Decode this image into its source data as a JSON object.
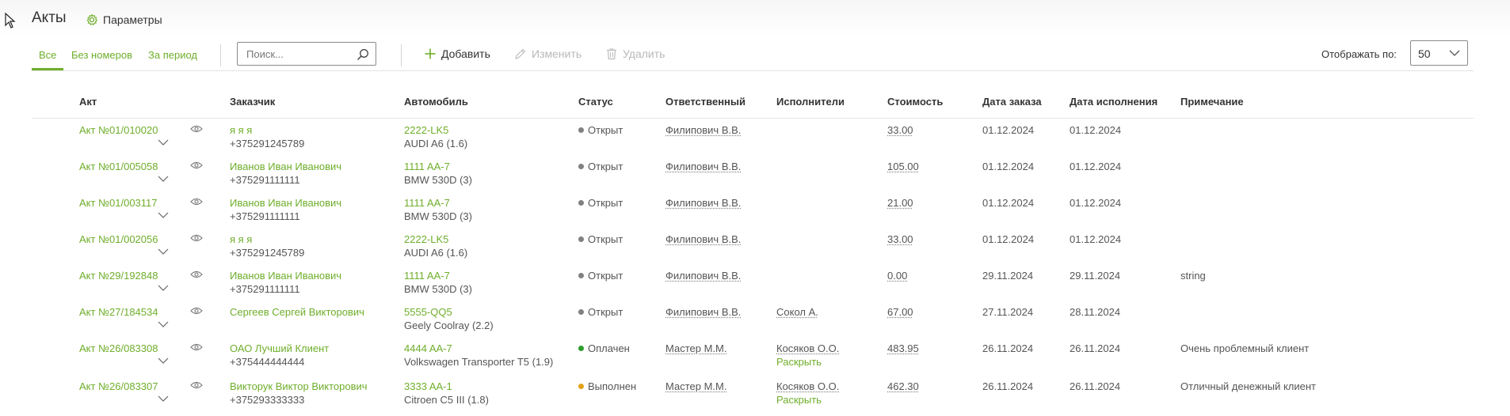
{
  "header": {
    "title": "Акты",
    "params_label": "Параметры"
  },
  "tabs": [
    {
      "label": "Все",
      "active": true
    },
    {
      "label": "Без номеров",
      "active": false
    },
    {
      "label": "За период",
      "active": false
    }
  ],
  "search": {
    "placeholder": "Поиск...",
    "value": ""
  },
  "actions": {
    "add": "Добавить",
    "edit": "Изменить",
    "delete": "Удалить"
  },
  "pager": {
    "label": "Отображать по:",
    "value": "50"
  },
  "columns": [
    "Акт",
    "Заказчик",
    "Автомобиль",
    "Статус",
    "Ответственный",
    "Исполнители",
    "Стоимость",
    "Дата заказа",
    "Дата исполнения",
    "Примечание"
  ],
  "status_colors": {
    "Открыт": "#808080",
    "Оплачен": "#2e9e2e",
    "Выполнен": "#e3a21a"
  },
  "accent_color": "#6fae2b",
  "rows": [
    {
      "act": "Акт №01/010020",
      "client": "я я я",
      "phone": "+375291245789",
      "car_plate": "2222-LK5",
      "car_model": "AUDI A6 (1.6)",
      "status": "Открыт",
      "status_color": "#808080",
      "responsible": "Филипович В.В.",
      "executors": "",
      "executors_more": "",
      "cost": "33.00",
      "order_date": "01.12.2024",
      "done_date": "01.12.2024",
      "note": ""
    },
    {
      "act": "Акт №01/005058",
      "client": "Иванов Иван Иванович",
      "phone": "+375291111111",
      "car_plate": "1111 AA-7",
      "car_model": "BMW 530D (3)",
      "status": "Открыт",
      "status_color": "#808080",
      "responsible": "Филипович В.В.",
      "executors": "",
      "executors_more": "",
      "cost": "105.00",
      "order_date": "01.12.2024",
      "done_date": "01.12.2024",
      "note": ""
    },
    {
      "act": "Акт №01/003117",
      "client": "Иванов Иван Иванович",
      "phone": "+375291111111",
      "car_plate": "1111 AA-7",
      "car_model": "BMW 530D (3)",
      "status": "Открыт",
      "status_color": "#808080",
      "responsible": "Филипович В.В.",
      "executors": "",
      "executors_more": "",
      "cost": "21.00",
      "order_date": "01.12.2024",
      "done_date": "01.12.2024",
      "note": ""
    },
    {
      "act": "Акт №01/002056",
      "client": "я я я",
      "phone": "+375291245789",
      "car_plate": "2222-LK5",
      "car_model": "AUDI A6 (1.6)",
      "status": "Открыт",
      "status_color": "#808080",
      "responsible": "Филипович В.В.",
      "executors": "",
      "executors_more": "",
      "cost": "33.00",
      "order_date": "01.12.2024",
      "done_date": "01.12.2024",
      "note": ""
    },
    {
      "act": "Акт №29/192848",
      "client": "Иванов Иван Иванович",
      "phone": "+375291111111",
      "car_plate": "1111 AA-7",
      "car_model": "BMW 530D (3)",
      "status": "Открыт",
      "status_color": "#808080",
      "responsible": "Филипович В.В.",
      "executors": "",
      "executors_more": "",
      "cost": "0.00",
      "order_date": "29.11.2024",
      "done_date": "29.11.2024",
      "note": "string"
    },
    {
      "act": "Акт №27/184534",
      "client": "Сергеев Сергей Викторович",
      "phone": "",
      "car_plate": "5555-QQ5",
      "car_model": "Geely Coolray (2.2)",
      "status": "Открыт",
      "status_color": "#808080",
      "responsible": "Филипович В.В.",
      "executors": "Сокол А.",
      "executors_more": "",
      "cost": "67.00",
      "order_date": "27.11.2024",
      "done_date": "28.11.2024",
      "note": ""
    },
    {
      "act": "Акт №26/083308",
      "client": "ОАО Лучший Клиент",
      "phone": "+375444444444",
      "car_plate": "4444 AA-7",
      "car_model": "Volkswagen Transporter T5 (1.9)",
      "status": "Оплачен",
      "status_color": "#2e9e2e",
      "responsible": "Мастер М.М.",
      "executors": "Косяков О.О.",
      "executors_more": "Раскрыть",
      "cost": "483.95",
      "order_date": "26.11.2024",
      "done_date": "26.11.2024",
      "note": "Очень проблемный клиент"
    },
    {
      "act": "Акт №26/083307",
      "client": "Викторук Виктор Викторович",
      "phone": "+375293333333",
      "car_plate": "3333 AA-1",
      "car_model": "Citroen C5 III (1.8)",
      "status": "Выполнен",
      "status_color": "#e3a21a",
      "responsible": "Мастер М.М.",
      "executors": "Косяков О.О.",
      "executors_more": "Раскрыть",
      "cost": "462.30",
      "order_date": "26.11.2024",
      "done_date": "26.11.2024",
      "note": "Отличный денежный клиент"
    }
  ]
}
